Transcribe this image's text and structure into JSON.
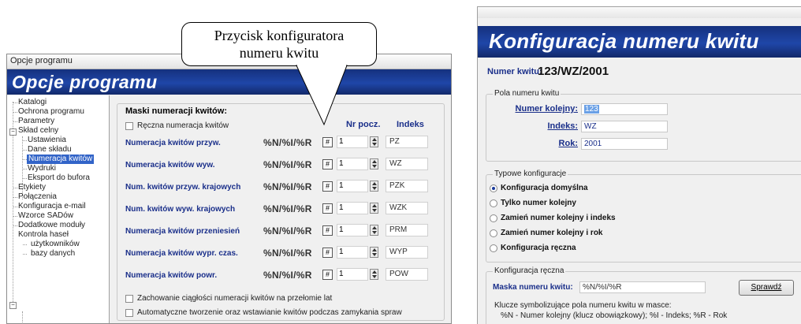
{
  "left_window": {
    "title": "Opcje programu",
    "banner": "Opcje programu",
    "tree": [
      {
        "label": "Katalogi"
      },
      {
        "label": "Ochrona programu"
      },
      {
        "label": "Parametry"
      },
      {
        "label": "Skład celny"
      },
      {
        "label": "Ustawienia"
      },
      {
        "label": "Dane składu"
      },
      {
        "label": "Numeracja kwitów"
      },
      {
        "label": "Wydruki"
      },
      {
        "label": "Eksport do bufora"
      },
      {
        "label": "Etykiety"
      },
      {
        "label": "Połączenia"
      },
      {
        "label": "Konfiguracja e-mail"
      },
      {
        "label": "Wzorce SADów"
      },
      {
        "label": "Dodatkowe moduły"
      },
      {
        "label": "Kontrola haseł"
      },
      {
        "label": "użytkowników"
      },
      {
        "label": "bazy danych"
      }
    ],
    "panel": {
      "title": "Maski numeracji kwitów:",
      "manual_checkbox": "Ręczna numeracja kwitów",
      "col_start": "Nr pocz.",
      "col_index": "Indeks",
      "cfg_icon": "#",
      "rows": [
        {
          "label": "Numeracja kwitów przyw.",
          "mask": "%N/%I/%R",
          "start": "1",
          "index": "PZ"
        },
        {
          "label": "Numeracja kwitów wyw.",
          "mask": "%N/%I/%R",
          "start": "1",
          "index": "WZ"
        },
        {
          "label": "Num. kwitów przyw. krajowych",
          "mask": "%N/%I/%R",
          "start": "1",
          "index": "PZK"
        },
        {
          "label": "Num. kwitów wyw. krajowych",
          "mask": "%N/%I/%R",
          "start": "1",
          "index": "WZK"
        },
        {
          "label": "Numeracja kwitów przeniesień",
          "mask": "%N/%I/%R",
          "start": "1",
          "index": "PRM"
        },
        {
          "label": "Numeracja kwitów wypr. czas.",
          "mask": "%N/%I/%R",
          "start": "1",
          "index": "WYP"
        },
        {
          "label": "Numeracja kwitów powr.",
          "mask": "%N/%I/%R",
          "start": "1",
          "index": "POW"
        }
      ],
      "option1": "Zachowanie ciągłości numeracji kwitów na przełomie lat",
      "option2": "Automatyczne tworzenie oraz wstawianie kwitów podczas zamykania spraw"
    }
  },
  "callout": {
    "line1": "Przycisk konfiguratora",
    "line2": "numeru kwitu"
  },
  "right_window": {
    "banner": "Konfiguracja numeru kwitu",
    "numer_label": "Numer kwitu:",
    "numer_value": "123/WZ/2001",
    "fields_group": "Pola numeru kwitu",
    "fields": [
      {
        "label": "Numer kolejny:",
        "value": "123"
      },
      {
        "label": "Indeks:",
        "value": "WZ"
      },
      {
        "label": "Rok:",
        "value": "2001"
      }
    ],
    "typical_group": "Typowe konfiguracje",
    "radios": [
      {
        "label": "Konfiguracja domyślna",
        "selected": true
      },
      {
        "label": "Tylko numer kolejny",
        "selected": false
      },
      {
        "label": "Zamień numer kolejny i indeks",
        "selected": false
      },
      {
        "label": "Zamień numer kolejny i rok",
        "selected": false
      },
      {
        "label": "Konfiguracja ręczna",
        "selected": false
      }
    ],
    "manual_group": "Konfiguracja ręczna",
    "mask_label": "Maska numeru kwitu:",
    "mask_value": "%N/%I/%R",
    "check_button": "Sprawdź",
    "note1": "Klucze symbolizujące pola numeru kwitu w masce:",
    "note2": "%N - Numer kolejny (klucz obowiązkowy); %I  - Indeks; %R - Rok"
  },
  "colors": {
    "banner": "#1f46a8",
    "label_blue": "#1a2f8a",
    "selection": "#3264c8"
  }
}
